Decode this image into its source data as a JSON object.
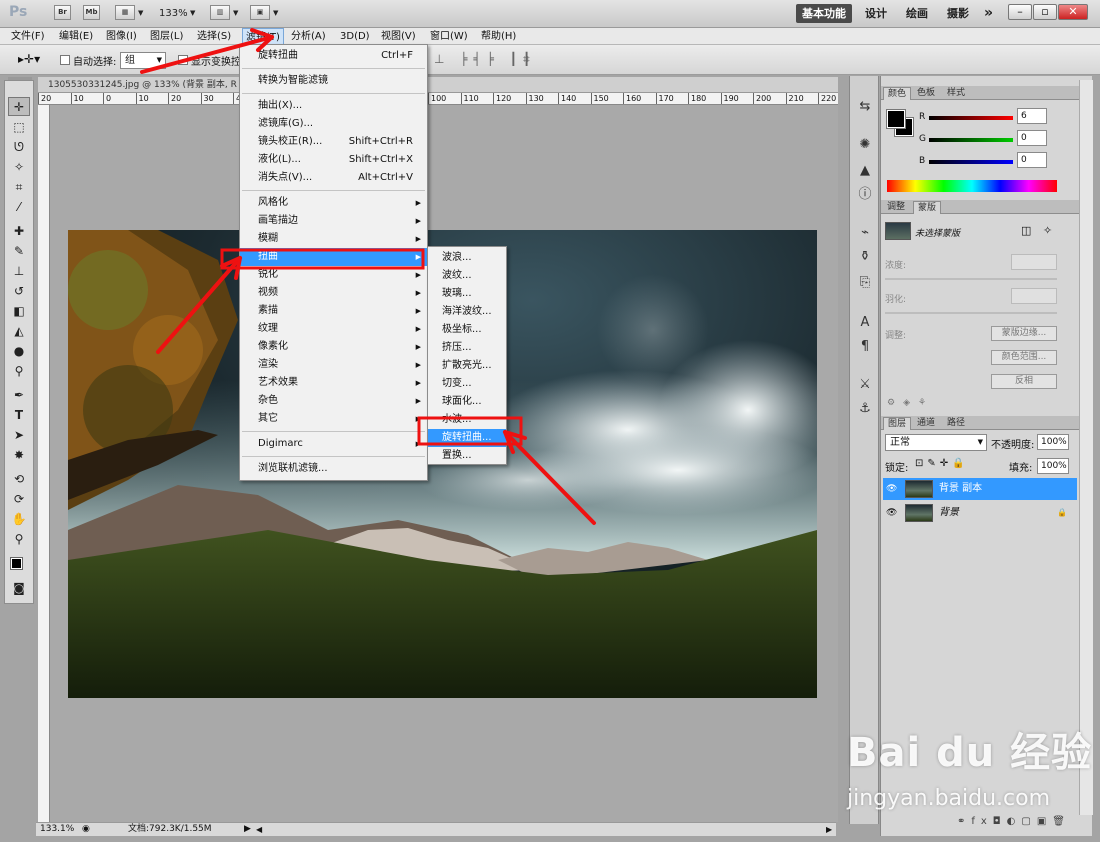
{
  "appbar": {
    "logo": "Ps",
    "btn_br": "Br",
    "btn_mb": "Mb",
    "zoom": "133%",
    "workspaces": [
      "基本功能",
      "设计",
      "绘画",
      "摄影"
    ],
    "more": "»"
  },
  "menubar": [
    "文件(F)",
    "编辑(E)",
    "图像(I)",
    "图层(L)",
    "选择(S)",
    "滤镜(T)",
    "分析(A)",
    "3D(D)",
    "视图(V)",
    "窗口(W)",
    "帮助(H)"
  ],
  "options": {
    "auto_select_label": "自动选择:",
    "auto_select_value": "组",
    "show_transform_label": "显示变换控"
  },
  "doc": {
    "tab_title": "1305530331245.jpg @ 133% (背景 副本, R",
    "ruler_ticks": [
      "20",
      "10",
      "0",
      "10",
      "20",
      "30",
      "40",
      "50",
      "60",
      "70",
      "80",
      "90",
      "100",
      "110",
      "120",
      "130",
      "140",
      "150",
      "160",
      "170",
      "180",
      "190",
      "200",
      "210",
      "220",
      "230"
    ],
    "zoom_status": "133.1%",
    "doc_size": "文档:792.3K/1.55M"
  },
  "filter_menu": {
    "items": [
      {
        "label": "旋转扭曲",
        "shortcut": "Ctrl+F"
      },
      {
        "sep": true
      },
      {
        "label": "转换为智能滤镜"
      },
      {
        "sep": true
      },
      {
        "label": "抽出(X)..."
      },
      {
        "label": "滤镜库(G)..."
      },
      {
        "label": "镜头校正(R)...",
        "shortcut": "Shift+Ctrl+R"
      },
      {
        "label": "液化(L)...",
        "shortcut": "Shift+Ctrl+X"
      },
      {
        "label": "消失点(V)...",
        "shortcut": "Alt+Ctrl+V"
      },
      {
        "sep": true
      },
      {
        "label": "风格化",
        "sub": true
      },
      {
        "label": "画笔描边",
        "sub": true
      },
      {
        "label": "模糊",
        "sub": true
      },
      {
        "label": "扭曲",
        "sub": true,
        "active": true
      },
      {
        "label": "锐化",
        "sub": true
      },
      {
        "label": "视频",
        "sub": true
      },
      {
        "label": "素描",
        "sub": true
      },
      {
        "label": "纹理",
        "sub": true
      },
      {
        "label": "像素化",
        "sub": true
      },
      {
        "label": "渲染",
        "sub": true
      },
      {
        "label": "艺术效果",
        "sub": true
      },
      {
        "label": "杂色",
        "sub": true
      },
      {
        "label": "其它",
        "sub": true
      },
      {
        "sep": true
      },
      {
        "label": "Digimarc",
        "sub": true
      },
      {
        "sep": true
      },
      {
        "label": "浏览联机滤镜..."
      }
    ]
  },
  "distort_submenu": {
    "items": [
      "波浪...",
      "波纹...",
      "玻璃...",
      "海洋波纹...",
      "极坐标...",
      "挤压...",
      "扩散亮光...",
      "切变...",
      "球面化...",
      "水波...",
      "旋转扭曲...",
      "置换..."
    ],
    "active_index": 10
  },
  "color_panel": {
    "tabs": [
      "颜色",
      "色板",
      "样式"
    ],
    "r": "6",
    "g": "0",
    "b": "0"
  },
  "adjust_panel": {
    "tabs": [
      "调整",
      "蒙版"
    ],
    "no_mask": "未选择蒙版",
    "density": "浓度:",
    "feather": "羽化:",
    "refine": "调整:",
    "btn_edge": "蒙版边缘...",
    "btn_range": "颜色范围...",
    "btn_invert": "反相"
  },
  "layers_panel": {
    "tabs": [
      "图层",
      "通道",
      "路径"
    ],
    "blend": "正常",
    "opacity_label": "不透明度:",
    "opacity": "100%",
    "lock_label": "锁定:",
    "fill_label": "填充:",
    "fill": "100%",
    "layers": [
      {
        "name": "背景 副本",
        "selected": true
      },
      {
        "name": "背景",
        "selected": false
      }
    ]
  },
  "watermark": {
    "brand": "Bai du 经验",
    "url": "jingyan.baidu.com"
  },
  "colors": {
    "highlight": "#3399ff",
    "annotation": "#ee1111"
  }
}
